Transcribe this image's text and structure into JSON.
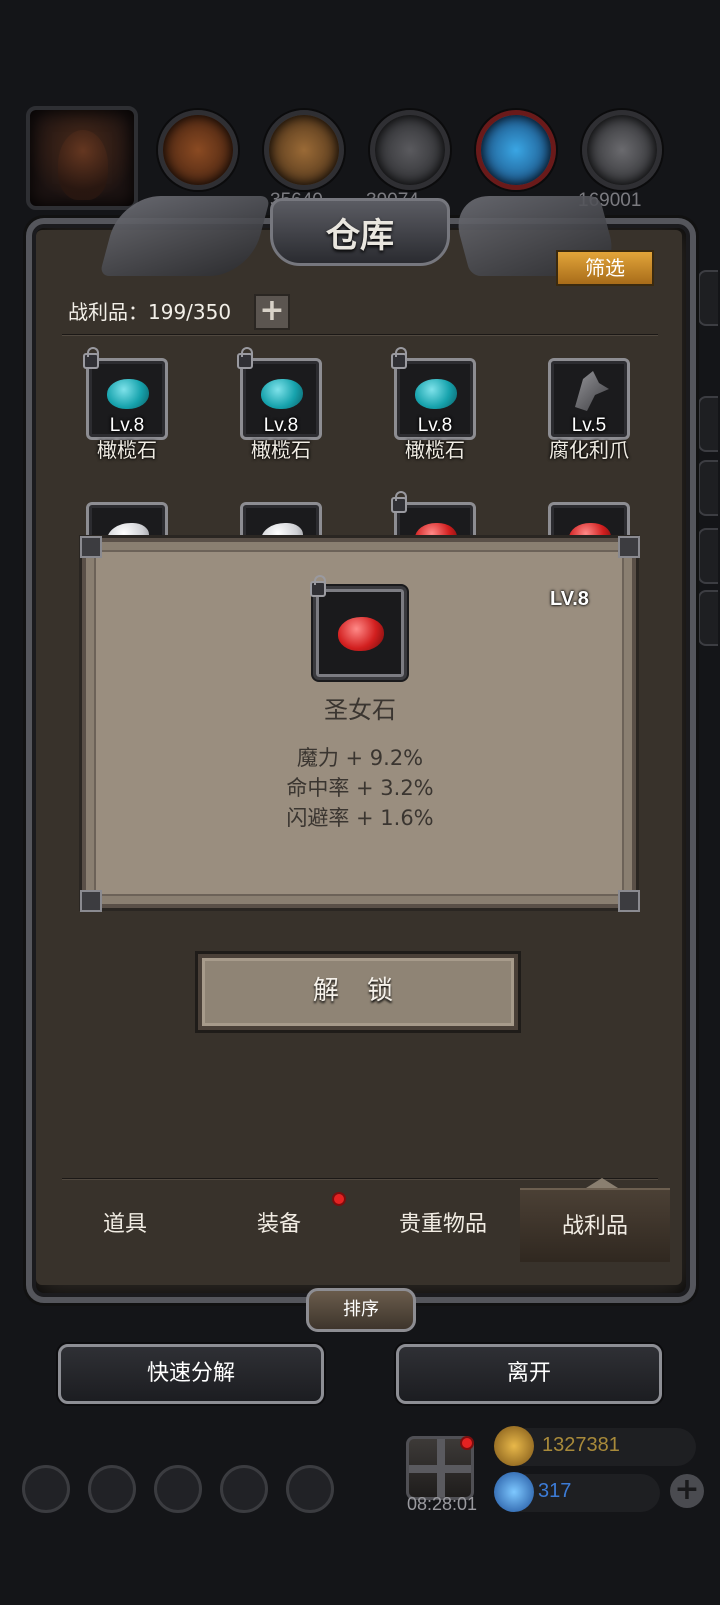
{
  "top_resources": {
    "values": [
      "",
      "35640",
      "39074",
      "",
      "169001"
    ]
  },
  "window": {
    "title": "仓库",
    "filter_label": "筛选"
  },
  "capacity": {
    "label": "战利品：199/350",
    "plus": "+"
  },
  "items_row1": [
    {
      "level": "Lv.8",
      "name": "橄榄石",
      "gem": "teal",
      "locked": true
    },
    {
      "level": "Lv.8",
      "name": "橄榄石",
      "gem": "teal",
      "locked": true
    },
    {
      "level": "Lv.8",
      "name": "橄榄石",
      "gem": "teal",
      "locked": true
    },
    {
      "level": "Lv.5",
      "name": "腐化利爪",
      "gem": "claw",
      "locked": false
    }
  ],
  "items_row2": [
    {
      "gem": "white",
      "locked": false
    },
    {
      "gem": "white",
      "locked": false
    },
    {
      "gem": "red",
      "locked": true
    },
    {
      "gem": "red",
      "locked": false
    }
  ],
  "tooltip": {
    "level": "LV.8",
    "name": "圣女石",
    "stats": [
      "魔力 + 9.2%",
      "命中率 + 3.2%",
      "闪避率 + 1.6%"
    ],
    "unlock_label": "解 锁"
  },
  "tabs": [
    {
      "label": "道具",
      "active": false
    },
    {
      "label": "装备",
      "active": false,
      "badge": true
    },
    {
      "label": "贵重物品",
      "active": false
    },
    {
      "label": "战利品",
      "active": true
    }
  ],
  "sort_label": "排序",
  "buttons": {
    "quick_decompose": "快速分解",
    "leave": "离开"
  },
  "hud": {
    "gift_timer": "08:28:01",
    "gold": "1327381",
    "diamonds": "317",
    "plus": "+"
  },
  "colors": {
    "filter": "#d18f2a",
    "badge": "#e42222",
    "gold_text": "#a88a3a",
    "diamond_text": "#3c7bd6"
  }
}
